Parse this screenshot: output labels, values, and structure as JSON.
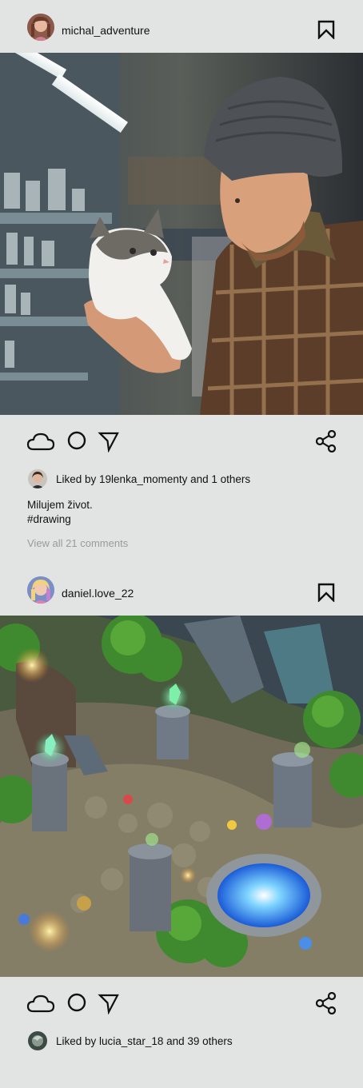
{
  "posts": [
    {
      "username": "michal_adventure",
      "likes_text": "Liked by 19lenka_momenty and 1 others",
      "caption_line1": "Milujem život.",
      "caption_line2": "#drawing",
      "view_comments": "View all 21 comments",
      "image_description": "man-in-beanie-holding-kitten-in-pet-store"
    },
    {
      "username": "daniel.love_22",
      "likes_text": "Liked by lucia_star_18 and 39 others",
      "image_description": "fantasy-game-map-with-towers-and-portal"
    }
  ],
  "icons": {
    "bookmark": "bookmark-icon",
    "like": "cloud-like-icon",
    "comment": "comment-circle-icon",
    "send": "send-icon",
    "share": "share-icon"
  },
  "colors": {
    "background": "#e2e4e3",
    "text": "#111111",
    "muted": "#9a9a9a"
  }
}
